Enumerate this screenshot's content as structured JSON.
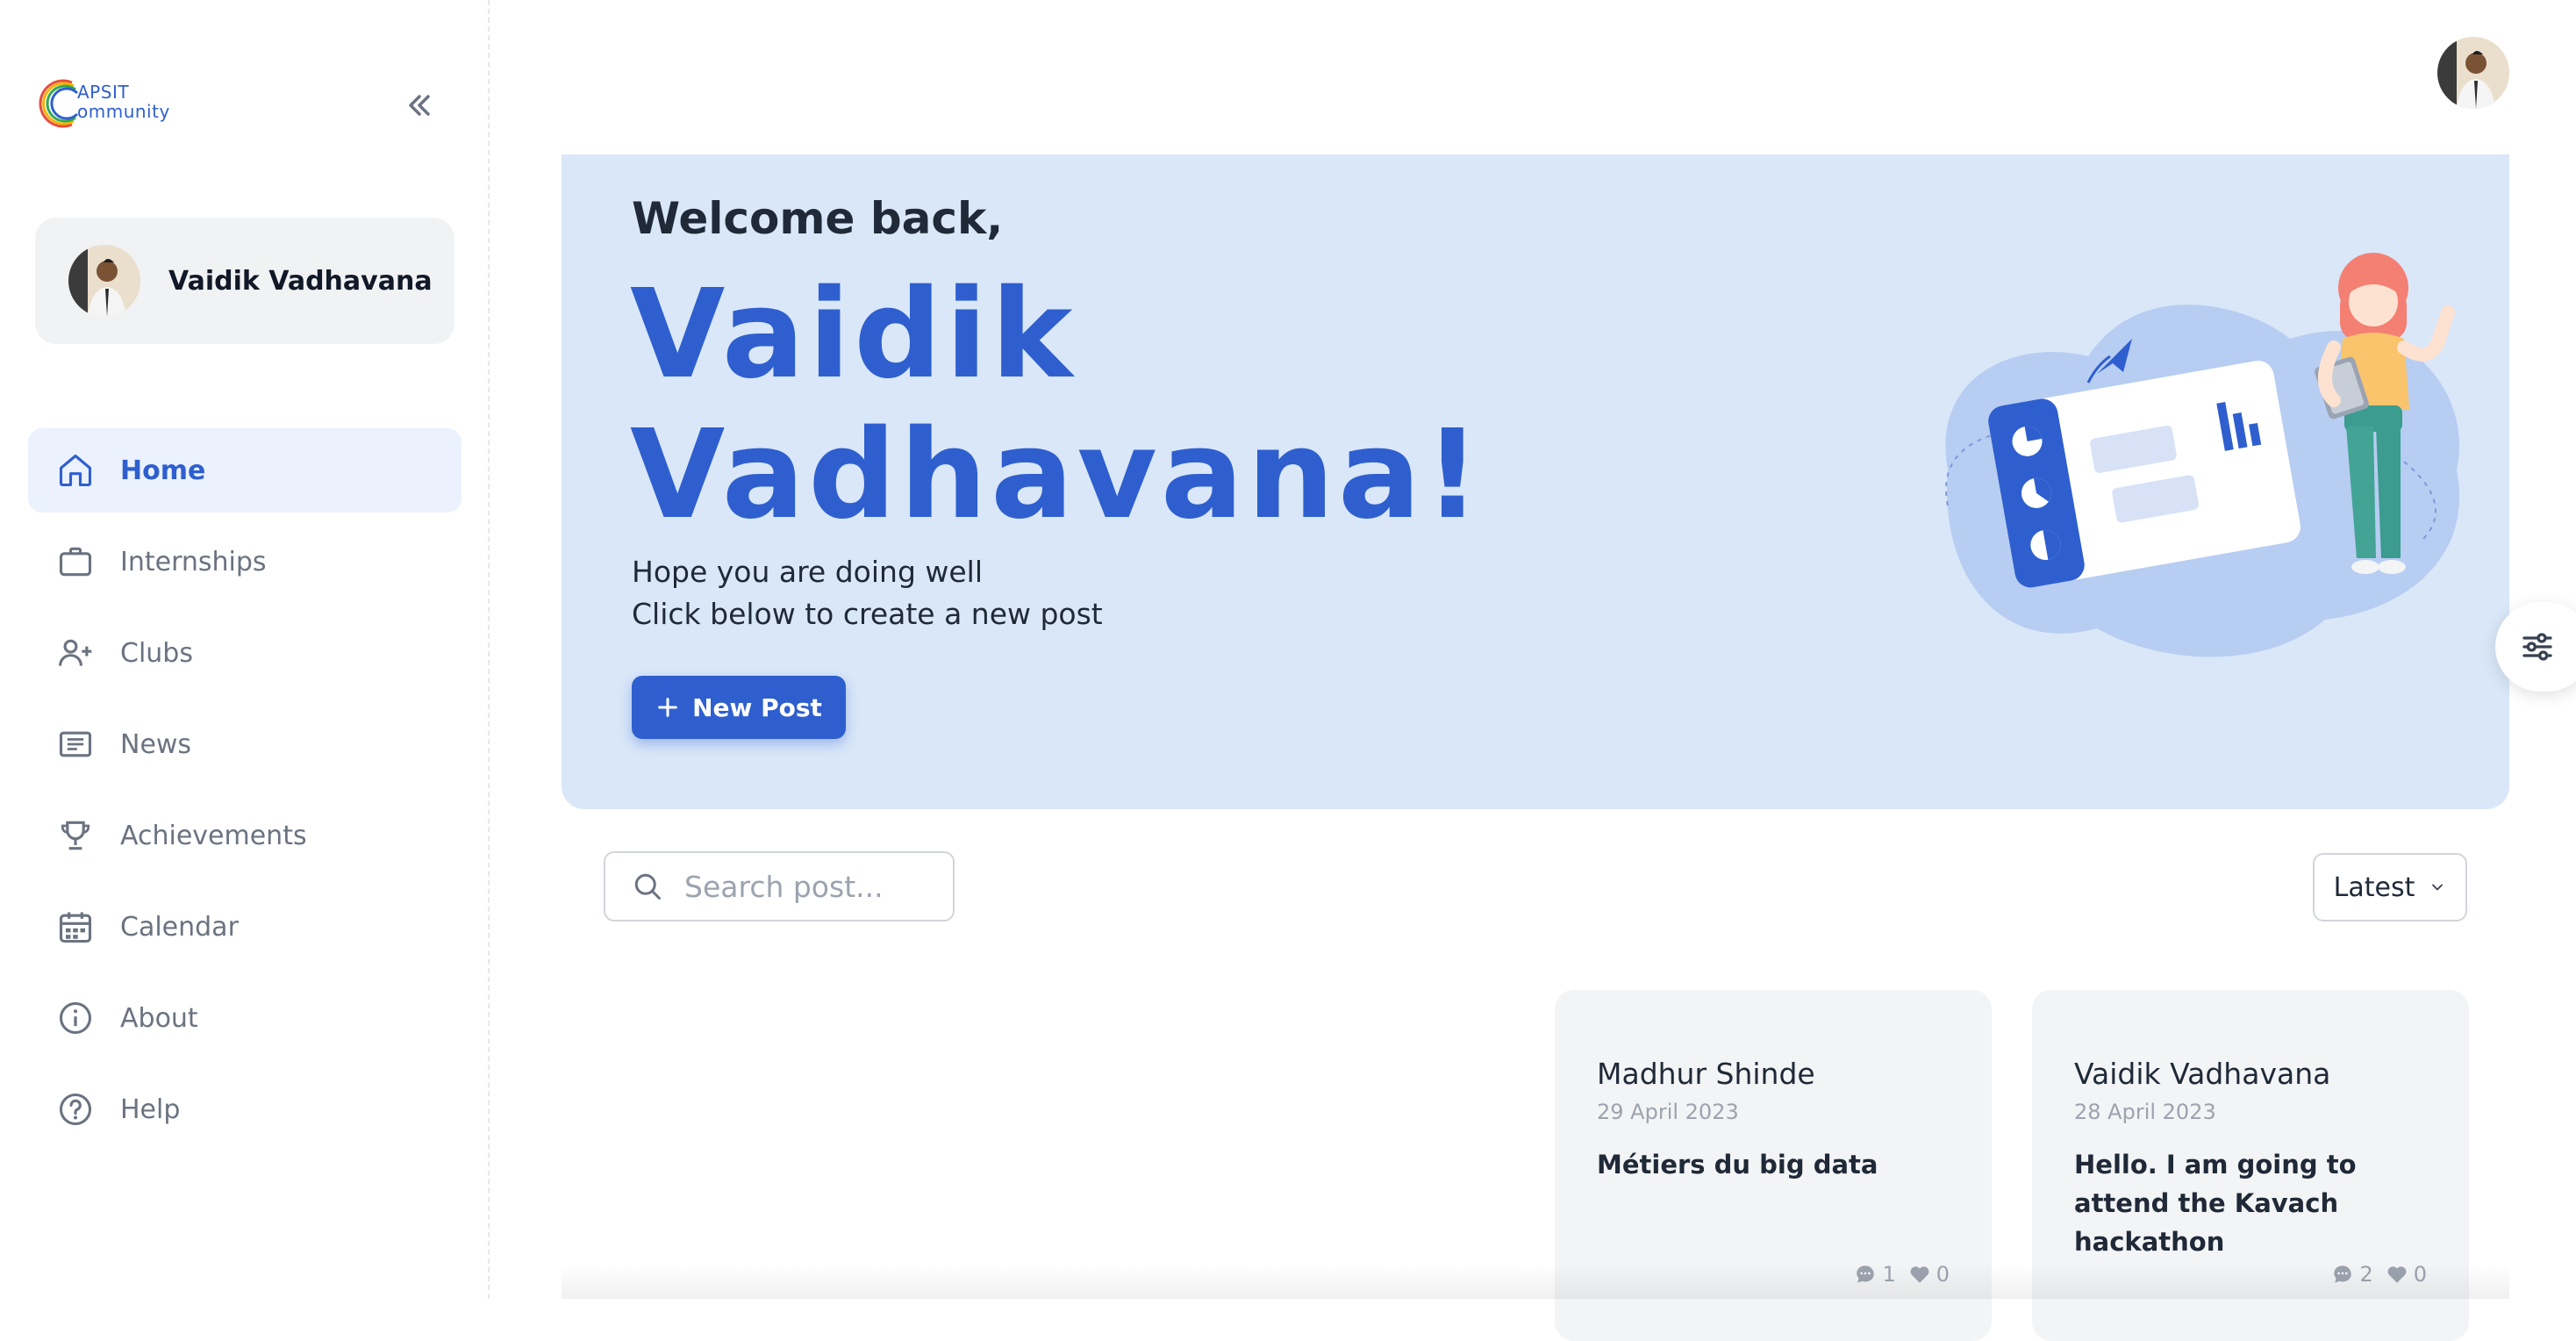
{
  "app": {
    "logo_line1": "APSIT",
    "logo_line2": "ommunity",
    "logo_letter": "C"
  },
  "sidebar": {
    "profile_name": "Vaidik Vadhavana",
    "items": [
      {
        "label": "Home",
        "icon": "home-icon",
        "active": true
      },
      {
        "label": "Internships",
        "icon": "briefcase-icon",
        "active": false
      },
      {
        "label": "Clubs",
        "icon": "users-add-icon",
        "active": false
      },
      {
        "label": "News",
        "icon": "newspaper-icon",
        "active": false
      },
      {
        "label": "Achievements",
        "icon": "trophy-icon",
        "active": false
      },
      {
        "label": "Calendar",
        "icon": "calendar-icon",
        "active": false
      },
      {
        "label": "About",
        "icon": "info-icon",
        "active": false
      },
      {
        "label": "Help",
        "icon": "help-icon",
        "active": false
      }
    ]
  },
  "hero": {
    "welcome": "Welcome back,",
    "name": "Vaidik Vadhavana!",
    "subtitle_line1": "Hope you are doing well",
    "subtitle_line2": "Click below to create a new post",
    "new_post_label": "New Post"
  },
  "toolbar": {
    "search_placeholder": "Search post...",
    "sort_value": "Latest"
  },
  "posts": [
    {
      "author": "Madhur Shinde",
      "date": "29 April 2023",
      "title": "Métiers du big data",
      "comments": "1",
      "likes": "0"
    },
    {
      "author": "Vaidik Vadhavana",
      "date": "28 April 2023",
      "title": "Hello. I am going to attend the Kavach hackathon",
      "comments": "2",
      "likes": "0"
    }
  ],
  "colors": {
    "accent": "#2f5fcf",
    "hero_bg": "#d9e7f8",
    "active_nav_bg": "#ebf2fd"
  }
}
